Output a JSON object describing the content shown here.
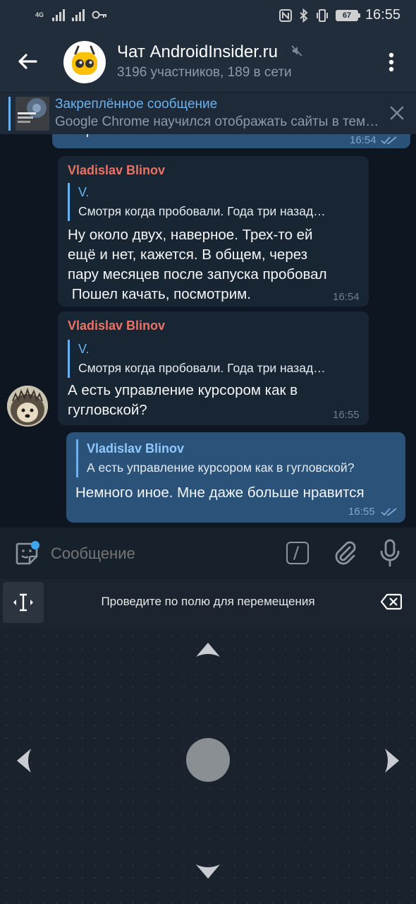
{
  "status_bar": {
    "network": "4G",
    "battery": "67",
    "time": "16:55"
  },
  "header": {
    "title": "Чат AndroidInsider.ru",
    "subtitle": "3196 участников, 189 в сети",
    "avatar_icon": "android-insider-logo-icon",
    "muted": true
  },
  "pinned": {
    "title": "Закреплённое сообщение",
    "text": "Google Chrome научился отображать сайты в темном режиме",
    "thumb_text": "Chrome научился отображать сайты"
  },
  "messages": {
    "partial_out": {
      "text": "попробовать",
      "time": "16:54"
    },
    "msg1": {
      "sender": "Vladislav Blinov",
      "reply_name": "V.",
      "reply_text": "Смотря когда пробовали. Года три назад…",
      "line1": "Ну около двух, наверное. Трех-то ей",
      "line2": "ещё и нет, кажется. В общем, через",
      "line3": "пару месяцев после запуска пробовал",
      "line4": " Пошел качать, посмотрим.",
      "time": "16:54"
    },
    "msg2": {
      "sender": "Vladislav Blinov",
      "reply_name": "V.",
      "reply_text": "Смотря когда пробовали. Года три назад…",
      "line1": "А есть управление курсором как в",
      "line2": "гугловской?",
      "time": "16:55"
    },
    "msg3": {
      "reply_name": "Vladislav Blinov",
      "reply_text": "А есть управление курсором как в гугловской?",
      "text": "Немного иное. Мне даже больше нравится",
      "time": "16:55"
    }
  },
  "composer": {
    "placeholder": "Сообщение"
  },
  "keyboard": {
    "hint": "Проведите по полю для перемещения"
  },
  "colors": {
    "accent": "#6ab3f3",
    "sender_name": "#ec7263",
    "incoming_bubble": "#182533",
    "outgoing_bubble": "#2b5278",
    "background": "#0e1621"
  }
}
